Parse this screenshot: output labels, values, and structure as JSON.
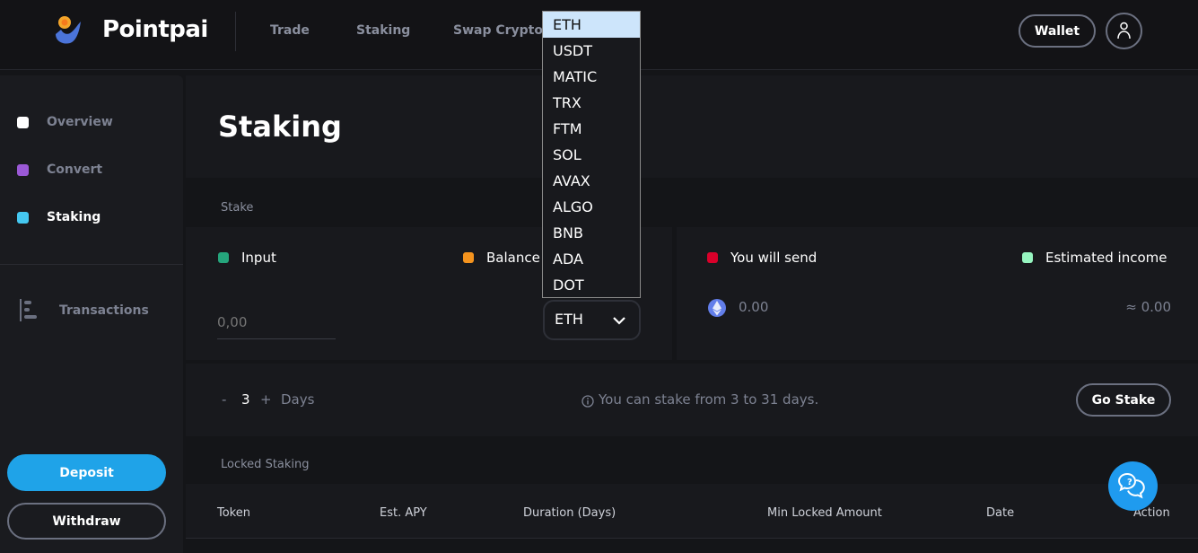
{
  "header": {
    "brand": "Pointpai",
    "nav": [
      "Trade",
      "Staking",
      "Swap Crypto"
    ],
    "wallet": "Wallet"
  },
  "sidebar": {
    "items": [
      {
        "label": "Overview",
        "color": "#ffffff"
      },
      {
        "label": "Convert",
        "color": "#9b59d6"
      },
      {
        "label": "Staking",
        "color": "#45c8f0"
      }
    ],
    "transactions": "Transactions",
    "deposit": "Deposit",
    "withdraw": "Withdraw"
  },
  "main": {
    "title": "Staking",
    "stake_label": "Stake",
    "input_label": "Input",
    "balance_label": "Balance",
    "input_placeholder": "0,00",
    "token": "ETH",
    "send_label": "You will send",
    "send_value": "0.00",
    "income_label": "Estimated income",
    "income_value": "≈ 0.00",
    "days_minus": "-",
    "days": "3",
    "days_plus": "+",
    "days_label": "Days",
    "info": "You can stake from 3 to 31 days.",
    "go_stake": "Go Stake",
    "locked_label": "Locked Staking",
    "columns": [
      "Token",
      "Est. APY",
      "Duration (Days)",
      "Min Locked Amount",
      "Date",
      "Action"
    ]
  },
  "dropdown": {
    "options": [
      "ETH",
      "USDT",
      "MATIC",
      "TRX",
      "FTM",
      "SOL",
      "AVAX",
      "ALGO",
      "BNB",
      "ADA",
      "DOT"
    ],
    "selected": "ETH"
  },
  "colors": {
    "input": "#25a57c",
    "balance": "#f4931e",
    "send": "#d9002a",
    "income": "#96f5c0",
    "accent": "#1fa3e8"
  }
}
